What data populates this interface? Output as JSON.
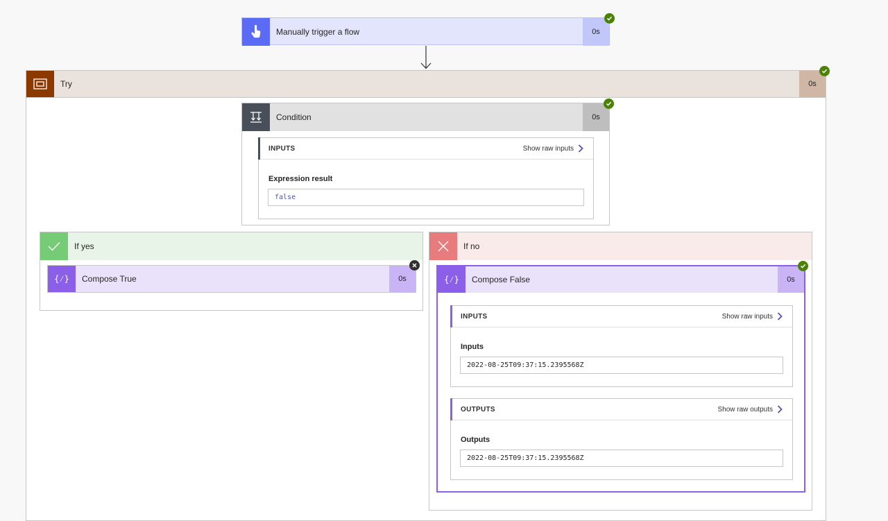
{
  "trigger": {
    "title": "Manually trigger a flow",
    "duration": "0s"
  },
  "try_scope": {
    "title": "Try",
    "duration": "0s"
  },
  "condition": {
    "title": "Condition",
    "duration": "0s",
    "inputs": {
      "section_title": "INPUTS",
      "raw_link": "Show raw inputs",
      "field_label": "Expression result",
      "field_value": "false"
    }
  },
  "branch_yes": {
    "title": "If yes",
    "action": {
      "title": "Compose True",
      "duration": "0s"
    }
  },
  "branch_no": {
    "title": "If no",
    "action": {
      "title": "Compose False",
      "duration": "0s",
      "inputs": {
        "section_title": "INPUTS",
        "raw_link": "Show raw inputs",
        "field_label": "Inputs",
        "field_value": "2022-08-25T09:37:15.2395568Z"
      },
      "outputs": {
        "section_title": "OUTPUTS",
        "raw_link": "Show raw outputs",
        "field_label": "Outputs",
        "field_value": "2022-08-25T09:37:15.2395568Z"
      }
    }
  },
  "colors": {
    "trigger": "#5c6bf5",
    "scope": "#8c3900",
    "condition": "#484f58",
    "compose": "#8c5fe8",
    "success": "#498205",
    "yes_branch": "#76cc76",
    "no_branch": "#e87c7c"
  },
  "icons": {
    "trigger": "hand-pointer-icon",
    "scope": "scope-icon",
    "condition": "condition-icon",
    "compose": "compose-icon",
    "yes": "checkmark-icon",
    "no": "cross-icon",
    "status_success": "success-check-icon",
    "status_skipped": "skipped-x-icon",
    "chevron": "chevron-right-icon"
  }
}
